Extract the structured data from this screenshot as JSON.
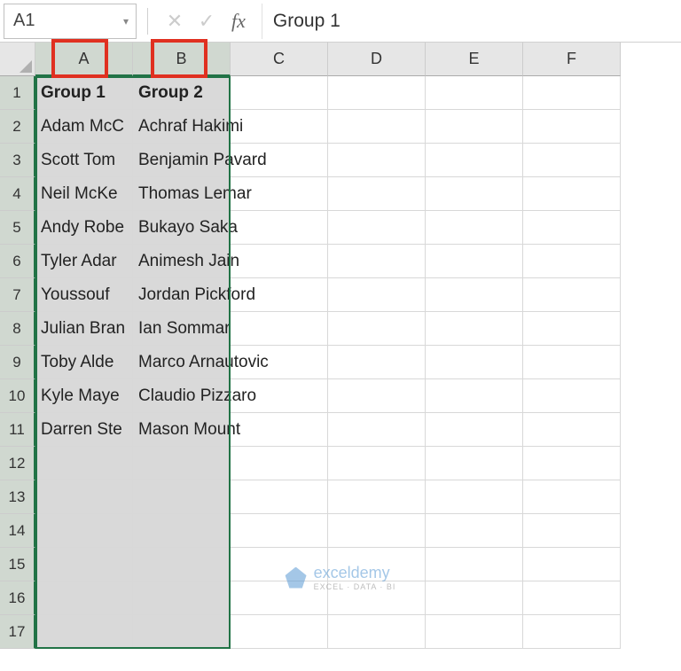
{
  "nameBox": {
    "value": "A1"
  },
  "formulaBar": {
    "value": "Group 1"
  },
  "columns": [
    "A",
    "B",
    "C",
    "D",
    "E",
    "F"
  ],
  "selectedCols": [
    0,
    1
  ],
  "rows": [
    1,
    2,
    3,
    4,
    5,
    6,
    7,
    8,
    9,
    10,
    11,
    12,
    13,
    14,
    15,
    16,
    17
  ],
  "maxDataRow": 11,
  "data": {
    "A": [
      "Group 1",
      "Adam McCoy",
      "Scott Tominey",
      "Neil McKenzie",
      "Andy Roberts",
      "Tyler Adams",
      "Youssouf Fofana",
      "Julian Brandt",
      "Toby Alderweireld",
      "Kyle Mayers",
      "Darren Stevens"
    ],
    "B": [
      "Group 2",
      "Achraf Hakimi",
      "Benjamin Pavard",
      "Thomas Lemar",
      "Bukayo Saka",
      "Animesh Jain",
      "Jordan Pickford",
      "Ian Sommar",
      "Marco Arnautovic",
      "Claudio Pizzaro",
      "Mason Mount"
    ]
  },
  "truncA": [
    "Group 1",
    "Adam McC",
    "Scott Tom",
    "Neil McKe",
    "Andy Robe",
    "Tyler Adar",
    "Youssouf ",
    "Julian Bran",
    "Toby Alde",
    "Kyle Maye",
    "Darren Ste"
  ],
  "watermark": {
    "brand": "exceldemy",
    "tagline": "EXCEL · DATA · BI"
  },
  "icons": {
    "dropdown": "▾",
    "cancel": "✕",
    "confirm": "✓"
  },
  "fx": "fx"
}
